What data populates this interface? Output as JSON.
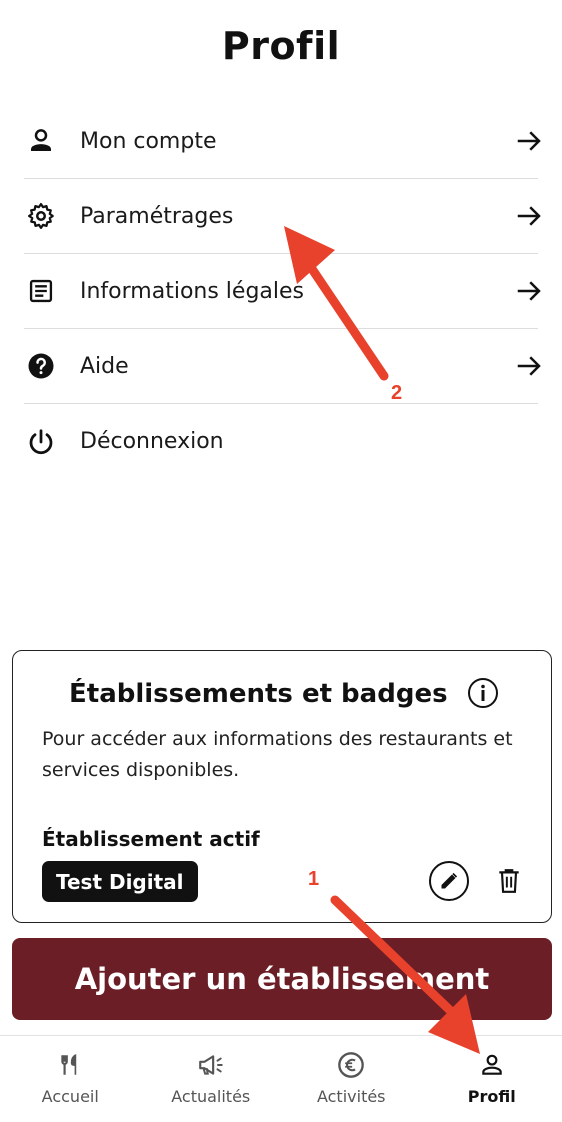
{
  "page": {
    "title": "Profil"
  },
  "menu": [
    {
      "label": "Mon compte",
      "icon": "person-icon",
      "has_arrow": true
    },
    {
      "label": "Paramétrages",
      "icon": "gear-icon",
      "has_arrow": true
    },
    {
      "label": "Informations légales",
      "icon": "document-icon",
      "has_arrow": true
    },
    {
      "label": "Aide",
      "icon": "help-icon",
      "has_arrow": true
    },
    {
      "label": "Déconnexion",
      "icon": "power-icon",
      "has_arrow": false
    }
  ],
  "card": {
    "title": "Établissements et badges",
    "description": "Pour accéder aux informations des restaurants et services disponibles.",
    "active_label": "Établissement actif",
    "active_badge": "Test Digital"
  },
  "add_button": {
    "label": "Ajouter un établissement"
  },
  "tabs": [
    {
      "label": "Accueil",
      "icon": "fork-knife-icon",
      "active": false
    },
    {
      "label": "Actualités",
      "icon": "megaphone-icon",
      "active": false
    },
    {
      "label": "Activités",
      "icon": "euro-icon",
      "active": false
    },
    {
      "label": "Profil",
      "icon": "person-icon",
      "active": true
    }
  ],
  "annotations": {
    "marker_1": "1",
    "marker_2": "2",
    "color": "#e8412c"
  },
  "colors": {
    "accent": "#6b1e26",
    "text": "#111111",
    "annotation": "#e8412c"
  }
}
